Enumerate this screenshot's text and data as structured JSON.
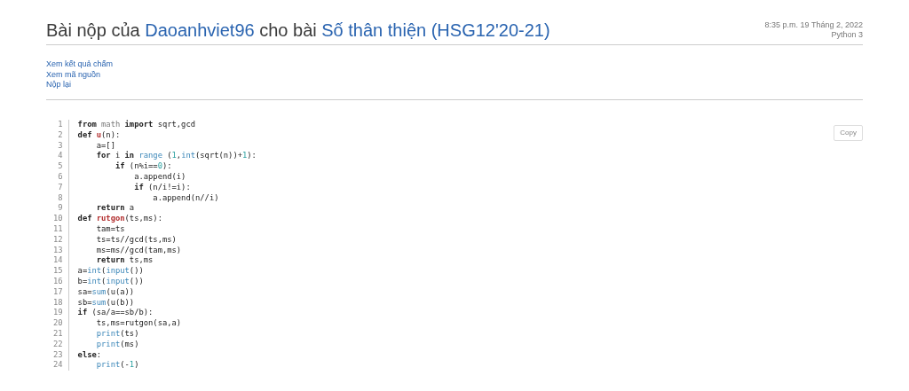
{
  "header": {
    "title_parts": [
      {
        "text": "Bài nộp của",
        "kind": "text"
      },
      {
        "text": "Daoanhviet96",
        "kind": "link"
      },
      {
        "text": "cho bài",
        "kind": "text"
      },
      {
        "text": "Số thân thiện (HSG12'20-21)",
        "kind": "link"
      }
    ],
    "timestamp": "8:35 p.m. 19 Tháng 2, 2022",
    "language": "Python 3"
  },
  "actions": [
    "Xem kết quả chấm",
    "Xem mã nguồn",
    "Nộp lại"
  ],
  "copy_button": "Copy",
  "code": [
    {
      "number": "1",
      "tokens": [
        {
          "t": "from",
          "kind": "keyword"
        },
        {
          "t": " math",
          "kind": "module"
        },
        {
          "t": " import",
          "kind": "keyword"
        },
        {
          "t": " sqrt,gcd",
          "kind": "plain"
        }
      ]
    },
    {
      "number": "2",
      "tokens": [
        {
          "t": "def",
          "kind": "keyword"
        },
        {
          "t": " u",
          "kind": "function"
        },
        {
          "t": "(n):",
          "kind": "plain"
        }
      ]
    },
    {
      "number": "3",
      "tokens": [
        {
          "t": "    a=[]",
          "kind": "plain"
        }
      ]
    },
    {
      "number": "4",
      "tokens": [
        {
          "t": "    for",
          "kind": "keyword"
        },
        {
          "t": " i",
          "kind": "plain"
        },
        {
          "t": " in",
          "kind": "keyword"
        },
        {
          "t": " range",
          "kind": "builtin"
        },
        {
          "t": " (",
          "kind": "plain"
        },
        {
          "t": "1",
          "kind": "number"
        },
        {
          "t": ",",
          "kind": "plain"
        },
        {
          "t": "int",
          "kind": "builtin"
        },
        {
          "t": "(sqrt(n))+",
          "kind": "plain"
        },
        {
          "t": "1",
          "kind": "number"
        },
        {
          "t": "):",
          "kind": "plain"
        }
      ]
    },
    {
      "number": "5",
      "tokens": [
        {
          "t": "        if",
          "kind": "keyword"
        },
        {
          "t": " (n%i==",
          "kind": "plain"
        },
        {
          "t": "0",
          "kind": "number"
        },
        {
          "t": "):",
          "kind": "plain"
        }
      ]
    },
    {
      "number": "6",
      "tokens": [
        {
          "t": "            a.append(i)",
          "kind": "plain"
        }
      ]
    },
    {
      "number": "7",
      "tokens": [
        {
          "t": "            if",
          "kind": "keyword"
        },
        {
          "t": " (n/i!=i):",
          "kind": "plain"
        }
      ]
    },
    {
      "number": "8",
      "tokens": [
        {
          "t": "                a.append(n//i)",
          "kind": "plain"
        }
      ]
    },
    {
      "number": "9",
      "tokens": [
        {
          "t": "    return",
          "kind": "keyword"
        },
        {
          "t": " a",
          "kind": "plain"
        }
      ]
    },
    {
      "number": "10",
      "tokens": [
        {
          "t": "def",
          "kind": "keyword"
        },
        {
          "t": " rutgon",
          "kind": "function"
        },
        {
          "t": "(ts,ms):",
          "kind": "plain"
        }
      ]
    },
    {
      "number": "11",
      "tokens": [
        {
          "t": "    tam=ts",
          "kind": "plain"
        }
      ]
    },
    {
      "number": "12",
      "tokens": [
        {
          "t": "    ts=ts//gcd(ts,ms)",
          "kind": "plain"
        }
      ]
    },
    {
      "number": "13",
      "tokens": [
        {
          "t": "    ms=ms//gcd(tam,ms)",
          "kind": "plain"
        }
      ]
    },
    {
      "number": "14",
      "tokens": [
        {
          "t": "    return",
          "kind": "keyword"
        },
        {
          "t": " ts,ms",
          "kind": "plain"
        }
      ]
    },
    {
      "number": "15",
      "tokens": [
        {
          "t": "a=",
          "kind": "plain"
        },
        {
          "t": "int",
          "kind": "builtin"
        },
        {
          "t": "(",
          "kind": "plain"
        },
        {
          "t": "input",
          "kind": "builtin"
        },
        {
          "t": "())",
          "kind": "plain"
        }
      ]
    },
    {
      "number": "16",
      "tokens": [
        {
          "t": "b=",
          "kind": "plain"
        },
        {
          "t": "int",
          "kind": "builtin"
        },
        {
          "t": "(",
          "kind": "plain"
        },
        {
          "t": "input",
          "kind": "builtin"
        },
        {
          "t": "())",
          "kind": "plain"
        }
      ]
    },
    {
      "number": "17",
      "tokens": [
        {
          "t": "sa=",
          "kind": "plain"
        },
        {
          "t": "sum",
          "kind": "builtin"
        },
        {
          "t": "(u(a))",
          "kind": "plain"
        }
      ]
    },
    {
      "number": "18",
      "tokens": [
        {
          "t": "sb=",
          "kind": "plain"
        },
        {
          "t": "sum",
          "kind": "builtin"
        },
        {
          "t": "(u(b))",
          "kind": "plain"
        }
      ]
    },
    {
      "number": "19",
      "tokens": [
        {
          "t": "if",
          "kind": "keyword"
        },
        {
          "t": " (sa/a==sb/b):",
          "kind": "plain"
        }
      ]
    },
    {
      "number": "20",
      "tokens": [
        {
          "t": "    ts,ms=rutgon(sa,a)",
          "kind": "plain"
        }
      ]
    },
    {
      "number": "21",
      "tokens": [
        {
          "t": "    print",
          "kind": "builtin"
        },
        {
          "t": "(ts)",
          "kind": "plain"
        }
      ]
    },
    {
      "number": "22",
      "tokens": [
        {
          "t": "    print",
          "kind": "builtin"
        },
        {
          "t": "(ms)",
          "kind": "plain"
        }
      ]
    },
    {
      "number": "23",
      "tokens": [
        {
          "t": "else",
          "kind": "keyword"
        },
        {
          "t": ":",
          "kind": "plain"
        }
      ]
    },
    {
      "number": "24",
      "tokens": [
        {
          "t": "    print",
          "kind": "builtin"
        },
        {
          "t": "(-",
          "kind": "plain"
        },
        {
          "t": "1",
          "kind": "number"
        },
        {
          "t": ")",
          "kind": "plain"
        }
      ]
    }
  ]
}
